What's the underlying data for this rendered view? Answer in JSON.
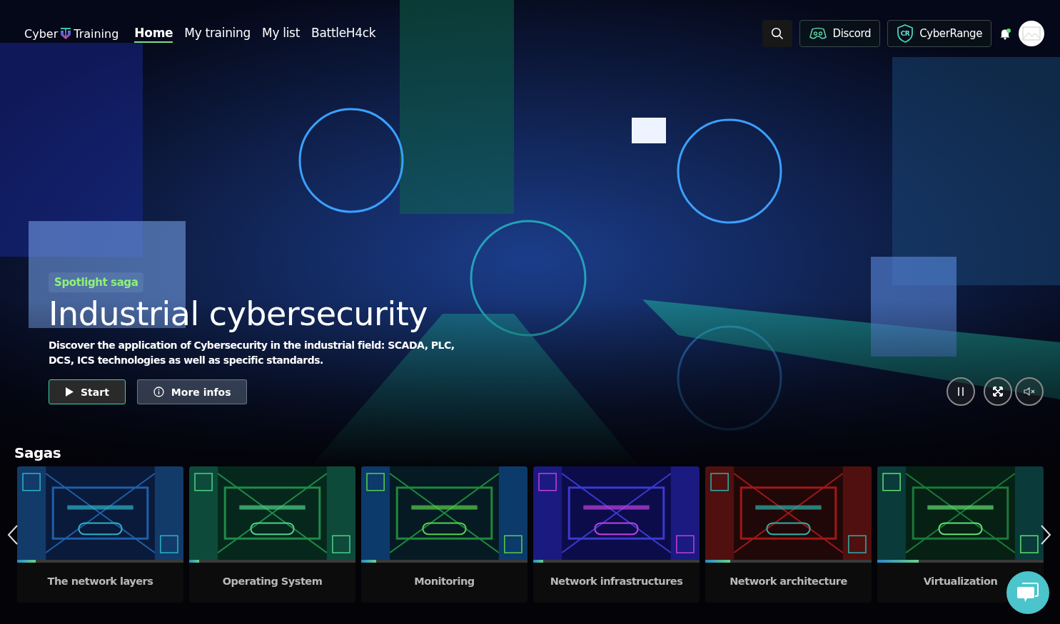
{
  "header": {
    "logo": {
      "left": "Cyber",
      "right": "Training"
    },
    "nav": [
      {
        "label": "Home",
        "selected": true
      },
      {
        "label": "My training",
        "selected": false
      },
      {
        "label": "My list",
        "selected": false
      },
      {
        "label": "BattleH4ck",
        "selected": false
      }
    ],
    "links": [
      {
        "kind": "discord",
        "label": "Discord"
      },
      {
        "kind": "cyberrange",
        "label": "CyberRange",
        "badge": "CR"
      }
    ],
    "notifications": {
      "unread": true
    }
  },
  "hero": {
    "kind": "picture",
    "tag": "Spotlight saga",
    "title": "Industrial cybersecurity",
    "description": "Discover the application of Cybersecurity in the industrial field: SCADA, PLC, DCS, ICS technologies as well as specific standards.",
    "buttons": [
      {
        "kind": "play",
        "label": "Start"
      },
      {
        "kind": "info",
        "label": "More infos"
      }
    ]
  },
  "sagas": {
    "heading": "Sagas",
    "items": [
      {
        "title": "The network layers",
        "level": 0.11
      },
      {
        "title": "Operating System",
        "level": 0.06
      },
      {
        "title": "Monitoring",
        "level": 0.09
      },
      {
        "title": "Network infrastructures",
        "level": 0.06
      },
      {
        "title": "Network architecture",
        "level": 0.15
      },
      {
        "title": "Virtualization",
        "level": 0.25
      }
    ]
  }
}
